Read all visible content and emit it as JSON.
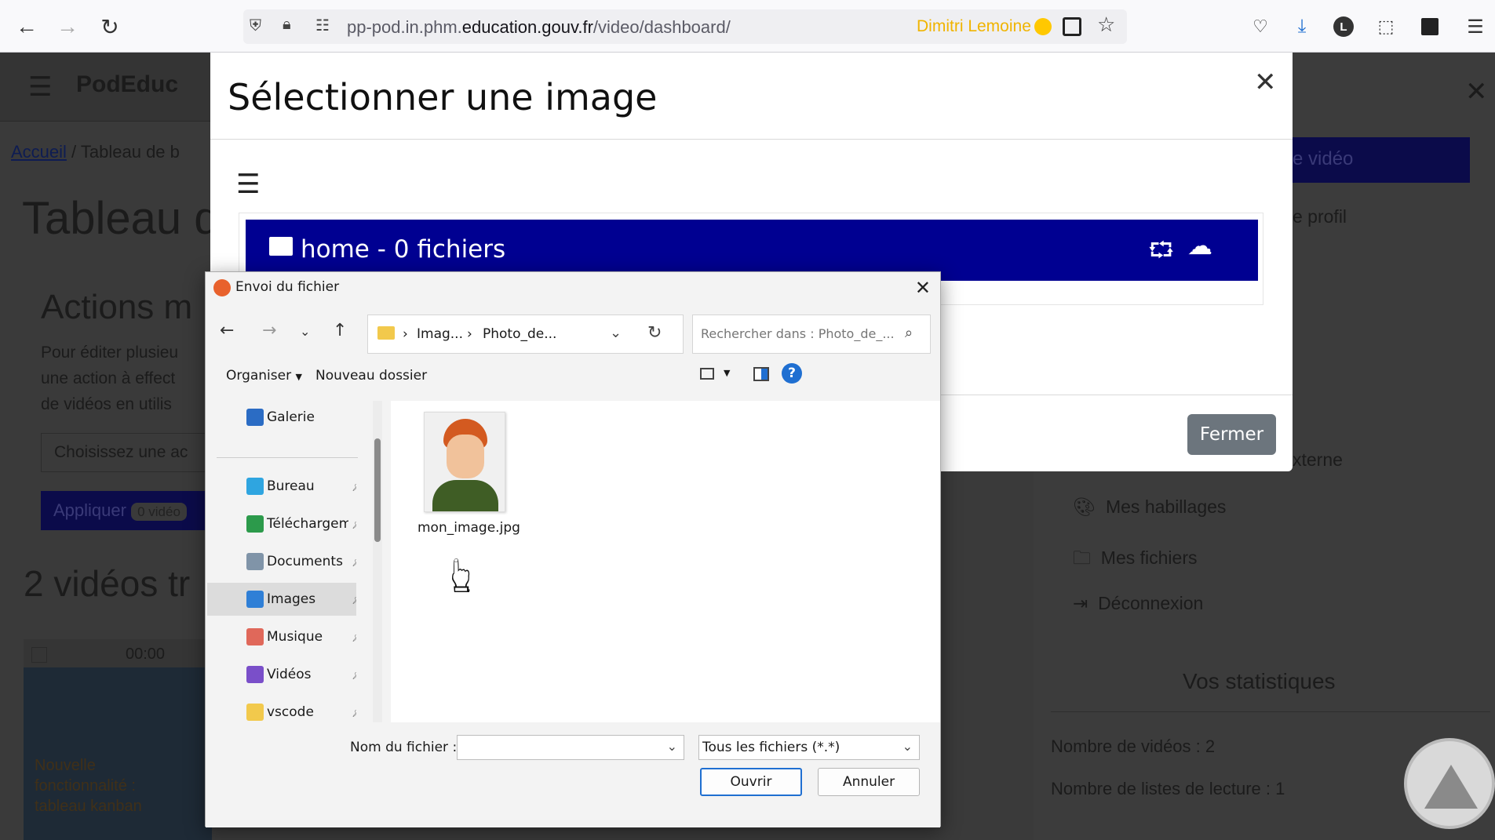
{
  "browser": {
    "url_prefix": "pp-pod.in.phm.",
    "url_domain": "education.gouv.fr",
    "url_path": "/video/dashboard/",
    "user_name": "Dimitri Lemoine",
    "profile_letter": "L"
  },
  "page": {
    "brand": "PodEduc",
    "breadcrumb_home": "Accueil",
    "breadcrumb_sep": "/",
    "breadcrumb_current": "Tableau de b",
    "page_title": "Tableau d",
    "actions_title": "Actions m",
    "actions_text": [
      "Pour éditer plusieu",
      "une action à effect",
      "de vidéos en utilis"
    ],
    "select_placeholder": "Choisissez une ac",
    "apply_label": "Appliquer",
    "apply_count": "0 vidéo",
    "videos_title": "2 vidéos tr",
    "video_duration": "00:00",
    "video_overlay": [
      "Nouvelle",
      "fonctionnalité :",
      "tableau kanban"
    ]
  },
  "sidebar": {
    "video_button": "e vidéo",
    "profile_item": "e profil",
    "external_item": "xterne",
    "items": [
      "Mes habillages",
      "Mes fichiers",
      "Déconnexion"
    ],
    "stats_title": "Vos statistiques",
    "stat_videos": "Nombre de vidéos : 2",
    "stat_playlists": "Nombre de listes de lecture : 1"
  },
  "image_modal": {
    "title": "Sélectionner une image",
    "folder_label": "home - 0 fichiers",
    "close_button": "Fermer"
  },
  "file_dialog": {
    "title": "Envoi du fichier",
    "path": [
      "Imag...",
      "Photo_de..."
    ],
    "search_placeholder": "Rechercher dans : Photo_de_...",
    "organize": "Organiser",
    "new_folder": "Nouveau dossier",
    "nav_items": [
      {
        "label": "Galerie",
        "color": "#2b6cc4",
        "pinned": false
      },
      {
        "label": "Bureau",
        "color": "#2fa5e0",
        "pinned": true
      },
      {
        "label": "Téléchargements",
        "color": "#2c9a4b",
        "pinned": true
      },
      {
        "label": "Documents",
        "color": "#8094a8",
        "pinned": true
      },
      {
        "label": "Images",
        "color": "#2f7fd6",
        "pinned": true
      },
      {
        "label": "Musique",
        "color": "#e0685a",
        "pinned": true
      },
      {
        "label": "Vidéos",
        "color": "#7a4fc9",
        "pinned": true
      },
      {
        "label": "vscode",
        "color": "#f2c94c",
        "pinned": true
      }
    ],
    "file_name": "mon_image.jpg",
    "filename_label": "Nom du fichier :",
    "filename_value": "",
    "filter": "Tous les fichiers (*.*)",
    "open_button": "Ouvrir",
    "cancel_button": "Annuler"
  }
}
